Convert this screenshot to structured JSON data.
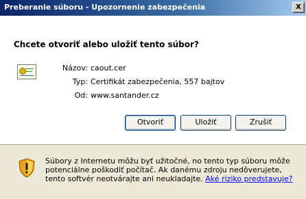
{
  "window": {
    "title": "Preberanie súboru - Upozornenie zabezpečenia",
    "close_glyph": "x"
  },
  "dialog": {
    "question": "Chcete otvoriť alebo uložiť tento súbor?",
    "file_icon": "certificate-icon",
    "fields": {
      "name_label": "Názov:",
      "name_value": "caout.cer",
      "type_label": "Typ:",
      "type_value": "Certifikát zabezpečenia, 557 bajtov",
      "from_label": "Od:",
      "from_value": "www.santander.cz"
    },
    "buttons": {
      "open": "Otvoriť",
      "save": "Uložiť",
      "cancel": "Zrušiť"
    }
  },
  "warning": {
    "icon": "shield-warning-icon",
    "line1": "Súbory z Internetu môžu byť užitočné, no tento typ súboru môže",
    "line2": "potenciálne poškodiť počítač. Ak danému zdroju nedôverujete,",
    "line3": "tento softvér neotvárajte ani neukladajte.",
    "link": "Aké riziko predstavuje?"
  },
  "colors": {
    "title_bar_start": "#0a246a",
    "dialog_bg": "#ece9d8",
    "panel_bg": "#ffffff",
    "link": "#0000ff"
  }
}
